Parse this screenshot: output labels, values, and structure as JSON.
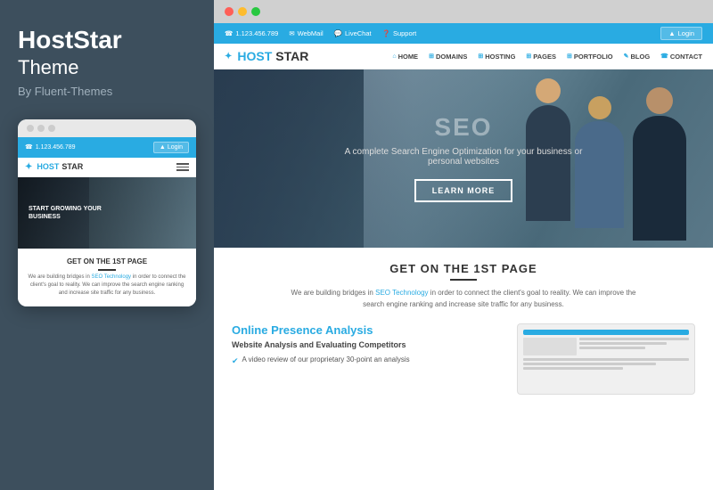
{
  "left": {
    "brand_name": "HostStar",
    "brand_subtitle": "Theme",
    "brand_author": "By Fluent-Themes",
    "mobile_preview": {
      "phone_number": "1.123.456.789",
      "login_label": "Login",
      "logo_host": "HOST",
      "logo_star": "STAR",
      "hero_text": "START GROWING YOUR",
      "hero_text2": "BUSINESS",
      "content_title": "GET ON THE 1ST PAGE",
      "content_description": "We are building bridges in",
      "content_link": "SEO Technology",
      "content_description2": "in order to connect the client's goal to reality. We can improve the search engine ranking and increase site traffic for any business."
    }
  },
  "right": {
    "chrome_dots": [
      "red",
      "yellow",
      "green"
    ],
    "site": {
      "top_bar": {
        "phone": "1.123.456.789",
        "webmail": "WebMail",
        "livechat": "LiveChat",
        "support": "Support",
        "login": "Login"
      },
      "nav": {
        "logo_host": "HOST",
        "logo_star": "STAR",
        "items": [
          "HOME",
          "DOMAINS",
          "HOSTING",
          "PAGES",
          "PORTFOLIO",
          "BLOG",
          "CONTACT"
        ]
      },
      "hero": {
        "seo_text": "SEO",
        "tagline": "A complete Search Engine Optimization for your business or personal websites",
        "button_label": "LEARN MORE"
      },
      "content": {
        "section_title": "GET ON THE 1ST PAGE",
        "description_pre": "We are building bridges in ",
        "description_link": "SEO Technology",
        "description_post": " in order to connect the client's goal to reality. We can improve the search engine ranking and increase site traffic for any business.",
        "presence_title_normal": "Online ",
        "presence_title_blue": "Presence Analysis",
        "presence_subtitle": "Website Analysis and Evaluating Competitors",
        "presence_items": [
          "A video review of our proprietary 30-point an analysis"
        ]
      }
    }
  },
  "colors": {
    "blue": "#29abe2",
    "dark": "#3d4f5d",
    "text_dark": "#333333",
    "text_light": "#666666"
  },
  "icons": {
    "phone": "☎",
    "user": "▲",
    "check": "✔",
    "star": "✦",
    "bars": "≡",
    "globe": "◉"
  }
}
